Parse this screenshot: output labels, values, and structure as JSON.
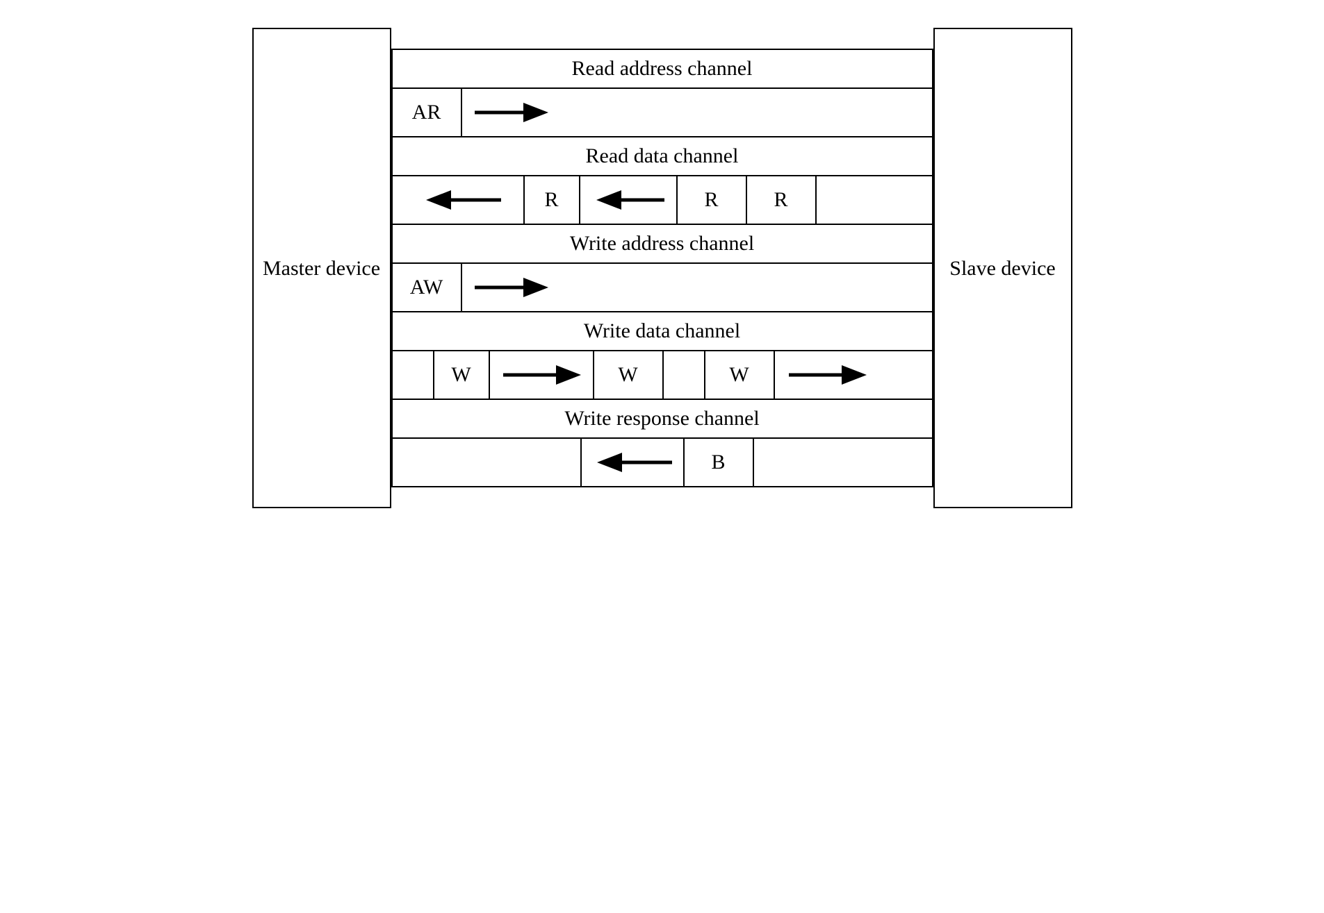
{
  "master_label": "Master device",
  "slave_label": "Slave device",
  "channels": {
    "read_addr": {
      "header": "Read address channel",
      "cells": {
        "ar": "AR"
      }
    },
    "read_data": {
      "header": "Read data channel",
      "cells": {
        "r1": "R",
        "r2": "R",
        "r3": "R"
      }
    },
    "write_addr": {
      "header": "Write address channel",
      "cells": {
        "aw": "AW"
      }
    },
    "write_data": {
      "header": "Write data channel",
      "cells": {
        "w1": "W",
        "w2": "W",
        "w3": "W"
      }
    },
    "write_resp": {
      "header": "Write response channel",
      "cells": {
        "b": "B"
      }
    }
  }
}
